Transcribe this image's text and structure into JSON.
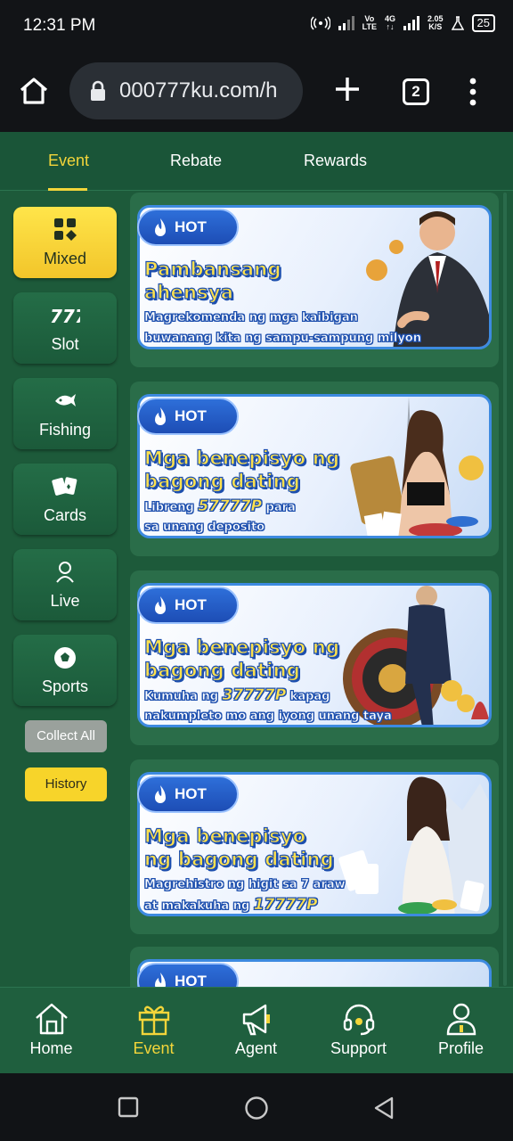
{
  "status_bar": {
    "time": "12:31 PM",
    "network_label_1": "Vo",
    "network_label_2": "LTE",
    "network_label_3": "4G",
    "speed_value": "2.05",
    "speed_unit": "K/S",
    "battery": "25"
  },
  "browser": {
    "url": "000777ku.com/h",
    "tab_count": "2"
  },
  "top_tabs": [
    {
      "label": "Event",
      "active": true
    },
    {
      "label": "Rebate",
      "active": false
    },
    {
      "label": "Rewards",
      "active": false
    }
  ],
  "sidebar": {
    "items": [
      {
        "label": "Mixed",
        "icon": "grid-icon",
        "active": true
      },
      {
        "label": "Slot",
        "icon": "slot-777-icon",
        "active": false
      },
      {
        "label": "Fishing",
        "icon": "fish-icon",
        "active": false
      },
      {
        "label": "Cards",
        "icon": "cards-icon",
        "active": false
      },
      {
        "label": "Live",
        "icon": "dealer-icon",
        "active": false
      },
      {
        "label": "Sports",
        "icon": "soccer-ball-icon",
        "active": false
      }
    ],
    "collect_all": "Collect All",
    "history": "History"
  },
  "banners": [
    {
      "badge": "HOT",
      "title_1": "Pambansang",
      "title_2": "ahensya",
      "sub_1": "Magrekomenda ng mga kaibigan",
      "sub_2": "buwanang kita ng sampu-sampung milyon"
    },
    {
      "badge": "HOT",
      "title_1": "Mga benepisyo ng",
      "title_2": "bagong dating",
      "sub_1a": "Libreng ",
      "sub_1_amount": "57777P",
      "sub_1b": " para",
      "sub_2": "sa unang deposito"
    },
    {
      "badge": "HOT",
      "title_1": "Mga benepisyo ng",
      "title_2": "bagong dating",
      "sub_1a": "Kumuha ng ",
      "sub_1_amount": "37777P",
      "sub_1b": " kapag",
      "sub_2": "nakumpleto mo ang iyong unang taya"
    },
    {
      "badge": "HOT",
      "title_1": "Mga benepisyo",
      "title_2": "ng bagong dating",
      "sub_1": "Magrehistro ng higit sa 7 araw",
      "sub_2a": "at makakuha ng ",
      "sub_2_amount": "17777P"
    },
    {
      "badge": "HOT"
    }
  ],
  "bottom_nav": [
    {
      "label": "Home",
      "icon": "home-icon",
      "active": false
    },
    {
      "label": "Event",
      "icon": "gift-icon",
      "active": true
    },
    {
      "label": "Agent",
      "icon": "megaphone-icon",
      "active": false
    },
    {
      "label": "Support",
      "icon": "headset-icon",
      "active": false
    },
    {
      "label": "Profile",
      "icon": "person-icon",
      "active": false
    }
  ],
  "colors": {
    "brand_green": "#1d5a3a",
    "accent_yellow": "#f3d53a",
    "hot_blue": "#2e6fd9"
  }
}
